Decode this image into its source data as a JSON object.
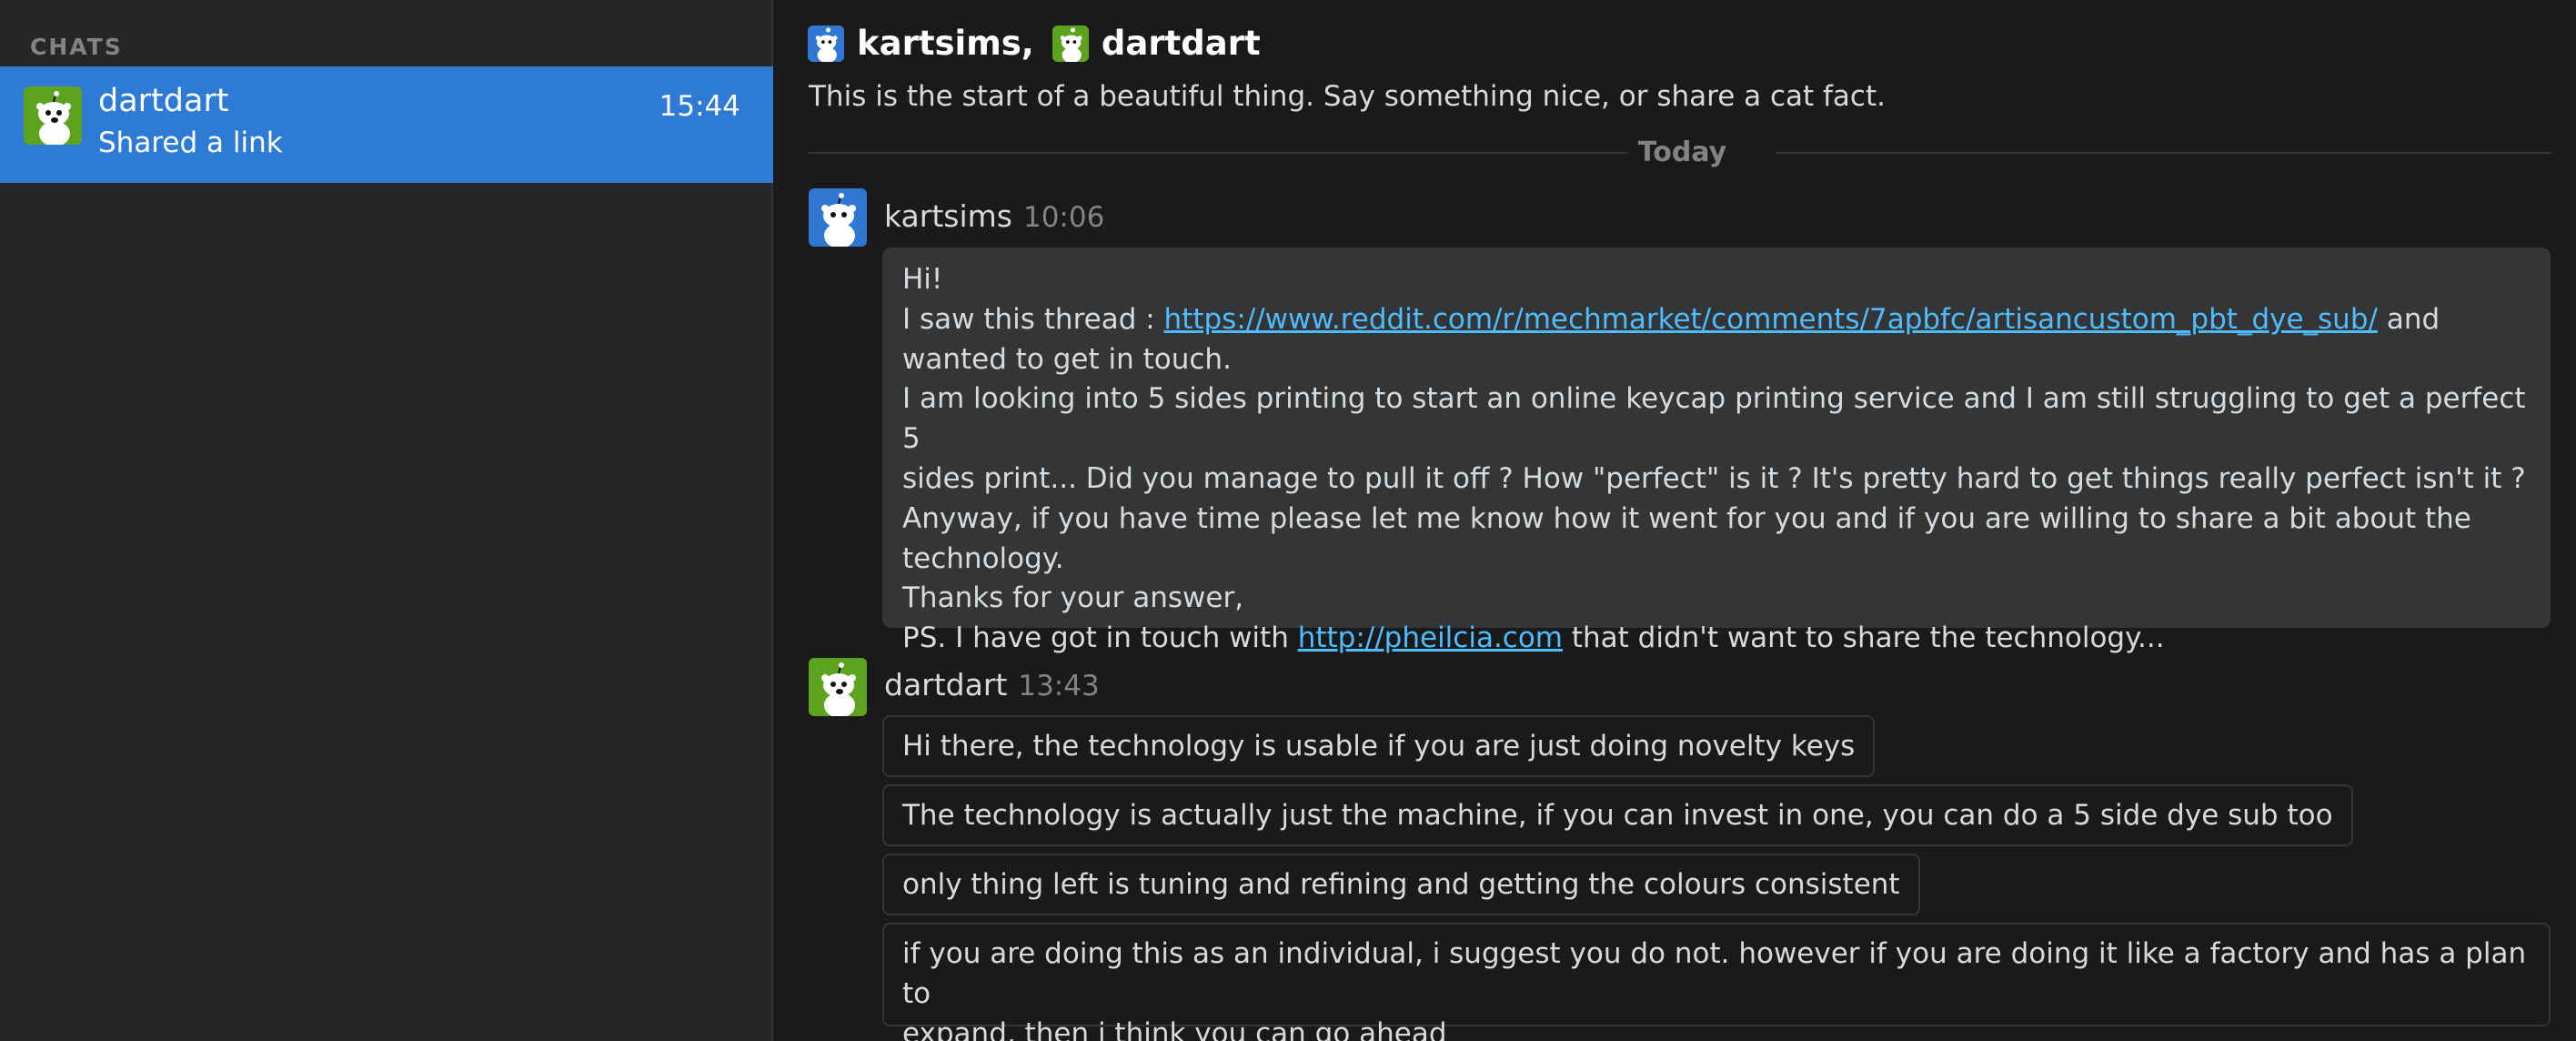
{
  "sidebar": {
    "heading": "CHATS",
    "chats": [
      {
        "name": "dartdart",
        "time": "15:44",
        "preview": "Shared a link",
        "avatar": "snoo-avatar-green"
      }
    ]
  },
  "header": {
    "participants": [
      {
        "name": "kartsims,",
        "avatar": "snoo-avatar-blue"
      },
      {
        "name": "dartdart",
        "avatar": "snoo-avatar-green"
      }
    ],
    "intro": "This is the start of a beautiful thing. Say something nice, or share a cat fact."
  },
  "divider": {
    "label": "Today"
  },
  "messages": [
    {
      "author": "kartsims",
      "time": "10:06",
      "avatar": "snoo-avatar-blue",
      "lines": {
        "l1": "Hi!",
        "l2_pre": "I saw this thread : ",
        "l2_link": "https://www.reddit.com/r/mechmarket/comments/7apbfc/artisancustom_pbt_dye_sub/",
        "l2_post": " and",
        "l3": "wanted to get in touch.",
        "l4": "I am looking into 5 sides printing to start an online keycap printing service and I am still struggling to get a perfect 5",
        "l5": "sides print... Did you manage to pull it off ? How \"perfect\" is it ? It's pretty hard to get things really perfect isn't it ?",
        "l6": "Anyway, if you have time please let me know how it went for you and if you are willing to share a bit about the",
        "l7": "technology.",
        "l8": "Thanks for your answer,",
        "l9_pre": "PS. I have got in touch with ",
        "l9_link": "http://pheilcia.com",
        "l9_post": " that didn't want to share the technology..."
      }
    },
    {
      "author": "dartdart",
      "time": "13:43",
      "avatar": "snoo-avatar-green",
      "bubbles": [
        "Hi there, the technology is usable if you are just doing novelty keys",
        "The technology is actually just the machine, if you can invest in one, you can do a 5 side dye sub too",
        "only thing left is tuning and refining and getting the colours consistent",
        "if you are doing this as an individual, i suggest you do not. however if you are doing it like a factory and has a plan to",
        "expand, then i think you can go ahead"
      ]
    }
  ],
  "colors": {
    "background": "#1a1a1b",
    "sidebar": "#272729",
    "selected": "#2e7bd6",
    "bubble": "#343536",
    "link": "#4fbcff",
    "avatar_green": "#5da31f",
    "avatar_blue": "#2f77d0"
  }
}
